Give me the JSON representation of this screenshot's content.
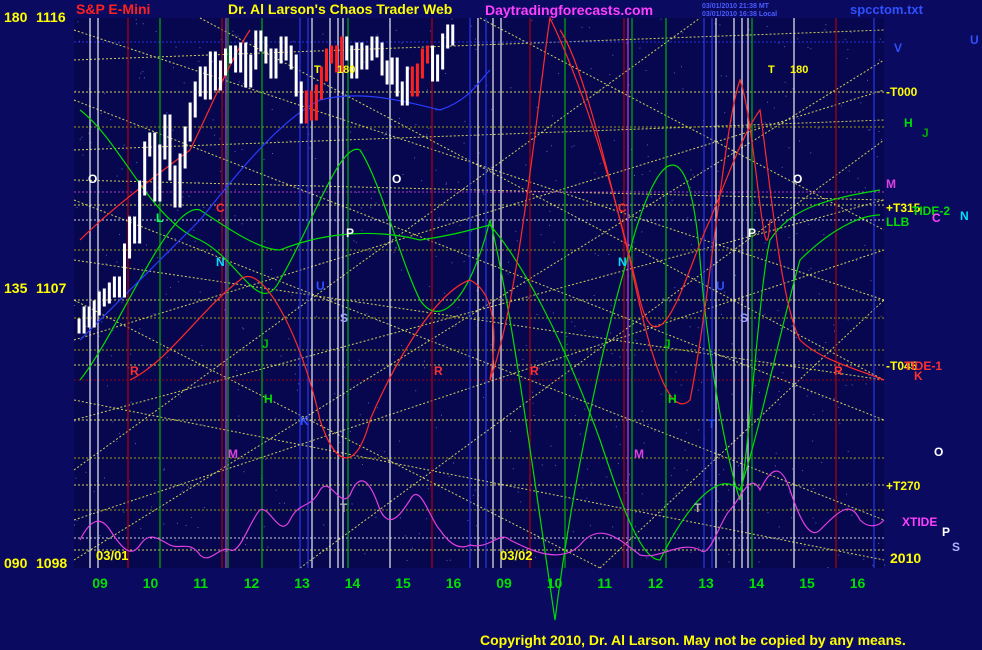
{
  "header": {
    "instrument": "S&P E-Mini",
    "site_title": "Dr. Al Larson's Chaos Trader Web",
    "site_url": "Daytradingforecasts.com",
    "timestamp_1": "03/01/2010 21:38 MT",
    "timestamp_2": "03/01/2010 16:38 Local",
    "file": "spcctom.txt"
  },
  "footer": {
    "copyright": "Copyright 2010, Dr. Al Larson. May not be copied by any means."
  },
  "colors": {
    "background": "#0a0a60",
    "plot_bg": "#070750",
    "price_bar": "#ffffff",
    "down_bar": "#ff2020",
    "tide": "#00dd00",
    "red_line": "#ff2a2a",
    "xtide": "#e040e0",
    "grid_green": "#00c000",
    "grid_red": "#c00000",
    "grid_yellow": "#ffff60",
    "grid_blue": "#2a3cff",
    "label_yellow": "#ffff00"
  },
  "chart_data": {
    "type": "line",
    "title": "S&P E-Mini",
    "xlabel": "",
    "ylabel": "",
    "y_axis_labels": [
      {
        "angle": "180",
        "price": "1116"
      },
      {
        "angle": "135",
        "price": "1107"
      },
      {
        "angle": "090",
        "price": "1098"
      }
    ],
    "ylim": [
      1098,
      1116
    ],
    "x_ticks": [
      "09",
      "10",
      "11",
      "12",
      "13",
      "14",
      "15",
      "16",
      "09",
      "10",
      "11",
      "12",
      "13",
      "14",
      "15",
      "16"
    ],
    "date_labels": [
      "03/01",
      "03/02"
    ],
    "year_label": "2010",
    "x": [
      8.6,
      8.7,
      8.8,
      8.9,
      9.0,
      9.1,
      9.2,
      9.3,
      9.4,
      9.5,
      9.6,
      9.7,
      9.8,
      9.9,
      10.0,
      10.1,
      10.2,
      10.3,
      10.4,
      10.5,
      10.6,
      10.7,
      10.8,
      10.9,
      11.0,
      11.1,
      11.2,
      11.3,
      11.4,
      11.5,
      11.6,
      11.7,
      11.8,
      11.9,
      12.0,
      12.1,
      12.2,
      12.3,
      12.4,
      12.5,
      12.6,
      12.7,
      12.8,
      12.9,
      13.0,
      13.1,
      13.2,
      13.3,
      13.4,
      13.5,
      13.6,
      13.7,
      13.8,
      13.9,
      14.0,
      14.1,
      14.2,
      14.3,
      14.4,
      14.5,
      14.6,
      14.7,
      14.8,
      14.9,
      15.0,
      15.1,
      15.2,
      15.3,
      15.4,
      15.5,
      15.6,
      15.7,
      15.8,
      15.9,
      16.0
    ],
    "series": [
      {
        "name": "S&P E-Mini",
        "values": [
          1105.8,
          1106.2,
          1106.0,
          1106.4,
          1106.7,
          1106.8,
          1107.0,
          1107.2,
          1107.0,
          1108.3,
          1109.2,
          1108.8,
          1110.4,
          1111.7,
          1112.0,
          1110.2,
          1111.6,
          1112.6,
          1110.9,
          1110.0,
          1111.3,
          1112.2,
          1113.0,
          1113.7,
          1114.2,
          1113.6,
          1114.7,
          1113.9,
          1114.4,
          1114.8,
          1114.9,
          1114.5,
          1115.0,
          1114.0,
          1114.6,
          1115.4,
          1115.2,
          1114.8,
          1114.3,
          1114.8,
          1115.2,
          1114.9,
          1114.6,
          1113.7,
          1112.8,
          1113.4,
          1112.9,
          1113.6,
          1114.2,
          1114.8,
          1114.9,
          1114.5,
          1115.2,
          1114.9,
          1114.3,
          1115.0,
          1114.6,
          1114.9,
          1115.2,
          1115.0,
          1114.4,
          1114.1,
          1114.5,
          1113.7,
          1113.4,
          1114.2,
          1113.7,
          1114.3,
          1114.8,
          1114.9,
          1114.2,
          1114.6,
          1115.3,
          1115.6,
          1115.4
        ]
      }
    ],
    "right_labels": [
      "V",
      "U",
      "-T000",
      "H",
      "J",
      "M",
      "+T315",
      "TIDE-2",
      "LLB",
      "C",
      "N",
      "-T045",
      "TIDE-1",
      "K",
      "O",
      "+T270",
      "XTIDE",
      "P",
      "S"
    ],
    "top_labels": [
      "T",
      "180",
      "T",
      "180"
    ],
    "plot_letters": [
      "O",
      "O",
      "O",
      "C",
      "C",
      "N",
      "N",
      "P",
      "P",
      "S",
      "S",
      "U",
      "U",
      "J",
      "J",
      "R",
      "R",
      "R",
      "R",
      "H",
      "H",
      "M",
      "M",
      "L",
      "K",
      "T",
      "T",
      "T"
    ]
  }
}
